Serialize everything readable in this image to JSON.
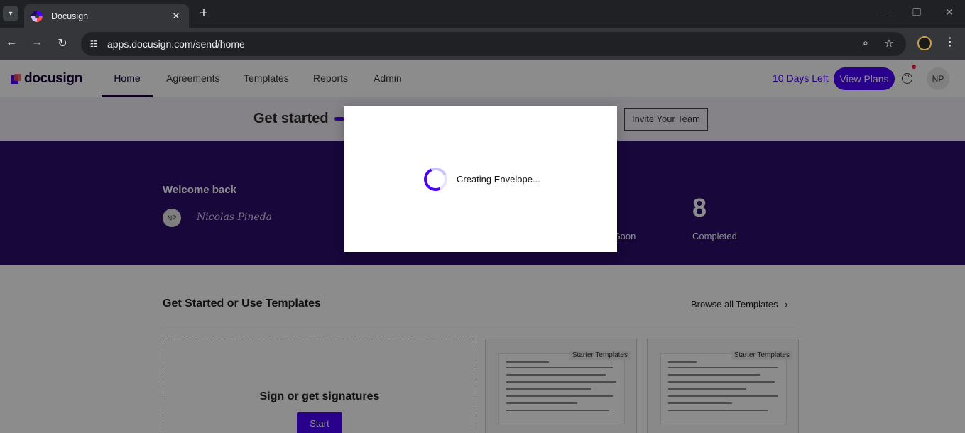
{
  "browser": {
    "tab_title": "Docusign",
    "url": "apps.docusign.com/send/home"
  },
  "app": {
    "logo_text": "docusign",
    "nav": [
      {
        "label": "Home",
        "active": true
      },
      {
        "label": "Agreements",
        "active": false
      },
      {
        "label": "Templates",
        "active": false
      },
      {
        "label": "Reports",
        "active": false
      },
      {
        "label": "Admin",
        "active": false
      }
    ],
    "days_left": "10 Days Left",
    "view_plans": "View Plans",
    "user_initials": "NP"
  },
  "get_started": {
    "title": "Get started",
    "invite_label": "Invite Your Team"
  },
  "welcome": {
    "title": "Welcome back",
    "avatar_initials": "NP",
    "signature": "Nicolas Pineda",
    "stats": [
      {
        "value": "",
        "label": "Soon"
      },
      {
        "value": "8",
        "label": "Completed"
      }
    ]
  },
  "templates_section": {
    "title": "Get Started or Use Templates",
    "browse_label": "Browse all Templates",
    "sign_card_title": "Sign or get signatures",
    "start_label": "Start",
    "cards": [
      {
        "badge": "Starter Templates"
      },
      {
        "badge": "Starter Templates"
      }
    ]
  },
  "modal": {
    "message": "Creating Envelope..."
  },
  "colors": {
    "brand_purple": "#4c00ff",
    "welcome_band": "#2a0e6b"
  }
}
